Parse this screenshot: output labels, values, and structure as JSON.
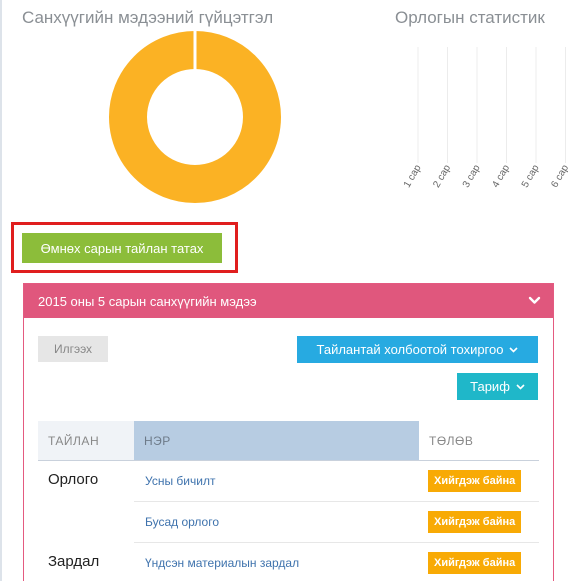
{
  "panels": {
    "finance_title": "Санхүүгийн мэдээний гүйцэтгэл",
    "income_title": "Орлогын статистик"
  },
  "colors": {
    "donut": "#fbb224",
    "report_button": "#8cbd3a",
    "box_header": "#e0577d",
    "blue_button": "#27aae1",
    "teal_button": "#1fb7c9",
    "badge": "#f8aa05",
    "highlight": "#e01e1e"
  },
  "income_chart": {
    "months": [
      "1 сар",
      "2 сар",
      "3 сар",
      "4 сар",
      "5 сар",
      "6 сар"
    ]
  },
  "report_button_label": "Өмнөх сарын тайлан татах",
  "box": {
    "title": "2015 оны 5 сарын санхүүгийн мэдээ",
    "chevron_icon": "chevron-down-icon",
    "send_button": "Илгээх",
    "settings_button": "Тайлантай холбоотой тохиргоо",
    "tariff_button": "Тариф"
  },
  "table": {
    "headers": [
      "ТАЙЛАН",
      "НЭР",
      "ТӨЛӨВ"
    ],
    "rows": [
      {
        "group": "Орлого",
        "name": "Усны бичилт",
        "status": "Хийгдэж байна"
      },
      {
        "group": "",
        "name": "Бусад орлого",
        "status": "Хийгдэж байна"
      },
      {
        "group": "Зардал",
        "name": "Үндсэн материалын зардал",
        "status": "Хийгдэж байна"
      }
    ]
  }
}
